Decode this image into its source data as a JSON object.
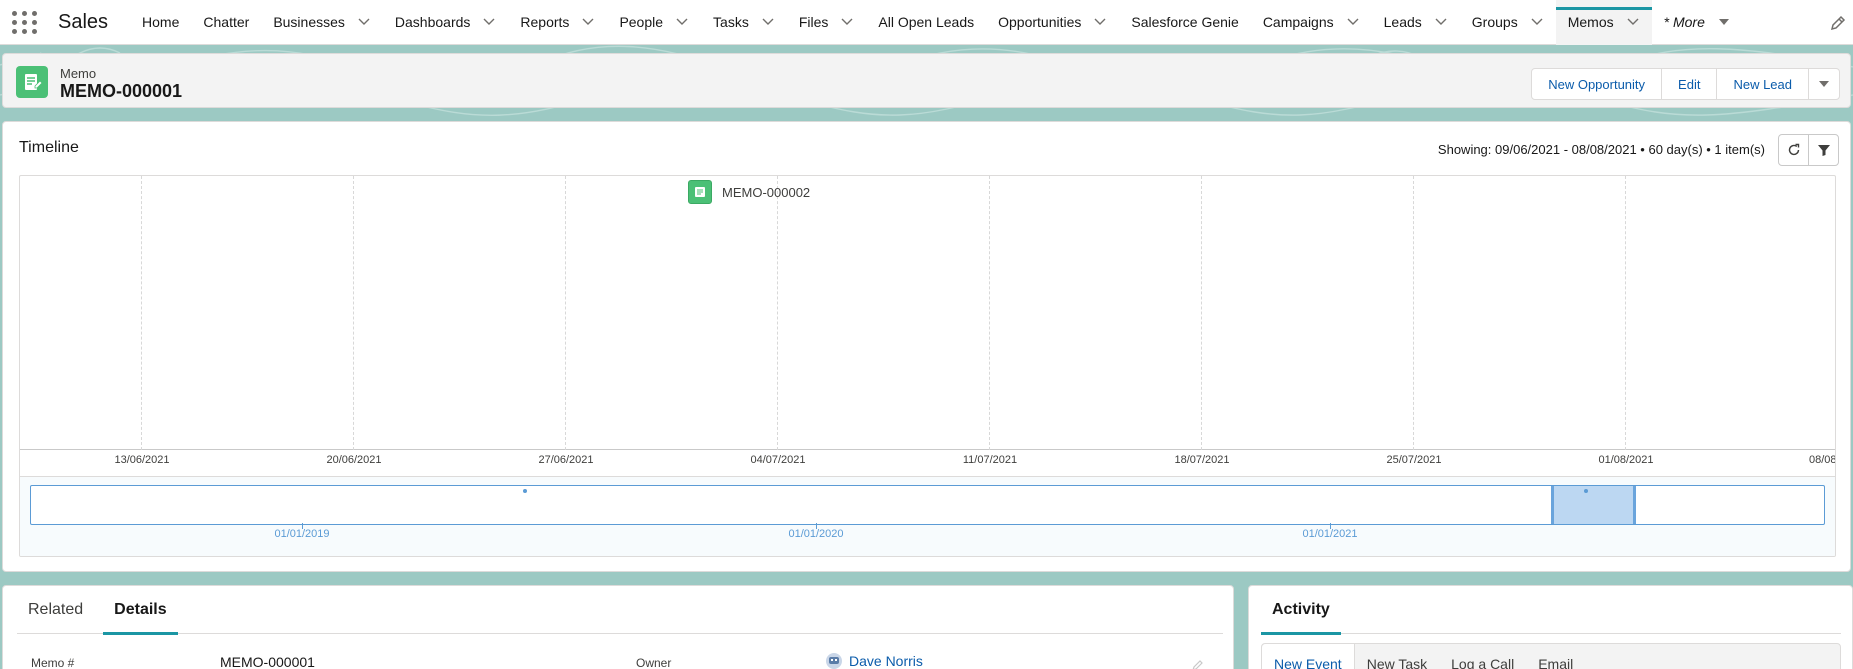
{
  "app": {
    "name": "Sales"
  },
  "nav": {
    "items": [
      {
        "label": "Home",
        "dropdown": false
      },
      {
        "label": "Chatter",
        "dropdown": false
      },
      {
        "label": "Businesses",
        "dropdown": true
      },
      {
        "label": "Dashboards",
        "dropdown": true
      },
      {
        "label": "Reports",
        "dropdown": true
      },
      {
        "label": "People",
        "dropdown": true
      },
      {
        "label": "Tasks",
        "dropdown": true
      },
      {
        "label": "Files",
        "dropdown": true
      },
      {
        "label": "All Open Leads",
        "dropdown": false
      },
      {
        "label": "Opportunities",
        "dropdown": true
      },
      {
        "label": "Salesforce Genie",
        "dropdown": false
      },
      {
        "label": "Campaigns",
        "dropdown": true
      },
      {
        "label": "Leads",
        "dropdown": true
      },
      {
        "label": "Groups",
        "dropdown": true
      },
      {
        "label": "Memos",
        "dropdown": true,
        "active": true
      }
    ],
    "more_label": "* More"
  },
  "record": {
    "object": "Memo",
    "title": "MEMO-000001",
    "actions": [
      "New Opportunity",
      "Edit",
      "New Lead"
    ]
  },
  "timeline": {
    "title": "Timeline",
    "showing": "Showing: 09/06/2021 - 08/08/2021 • 60 day(s) • 1 item(s)",
    "event_label": "MEMO-000002",
    "ticks": [
      "13/06/2021",
      "20/06/2021",
      "27/06/2021",
      "04/07/2021",
      "11/07/2021",
      "18/07/2021",
      "25/07/2021",
      "01/08/2021",
      "08/08"
    ],
    "overview_labels": [
      "01/01/2019",
      "01/01/2020",
      "01/01/2021"
    ]
  },
  "details": {
    "tabs": [
      "Related",
      "Details"
    ],
    "active_tab": "Details",
    "fields": {
      "memo_label": "Memo #",
      "memo_value": "MEMO-000001",
      "owner_label": "Owner",
      "owner_value": "Dave Norris"
    }
  },
  "activity": {
    "title": "Activity",
    "buttons": [
      "New Event",
      "New Task",
      "Log a Call",
      "Email"
    ]
  },
  "colors": {
    "accent": "#1b96a4",
    "link": "#0b5cab",
    "memo_icon": "#4bc076",
    "band": "#9cc9c3"
  }
}
